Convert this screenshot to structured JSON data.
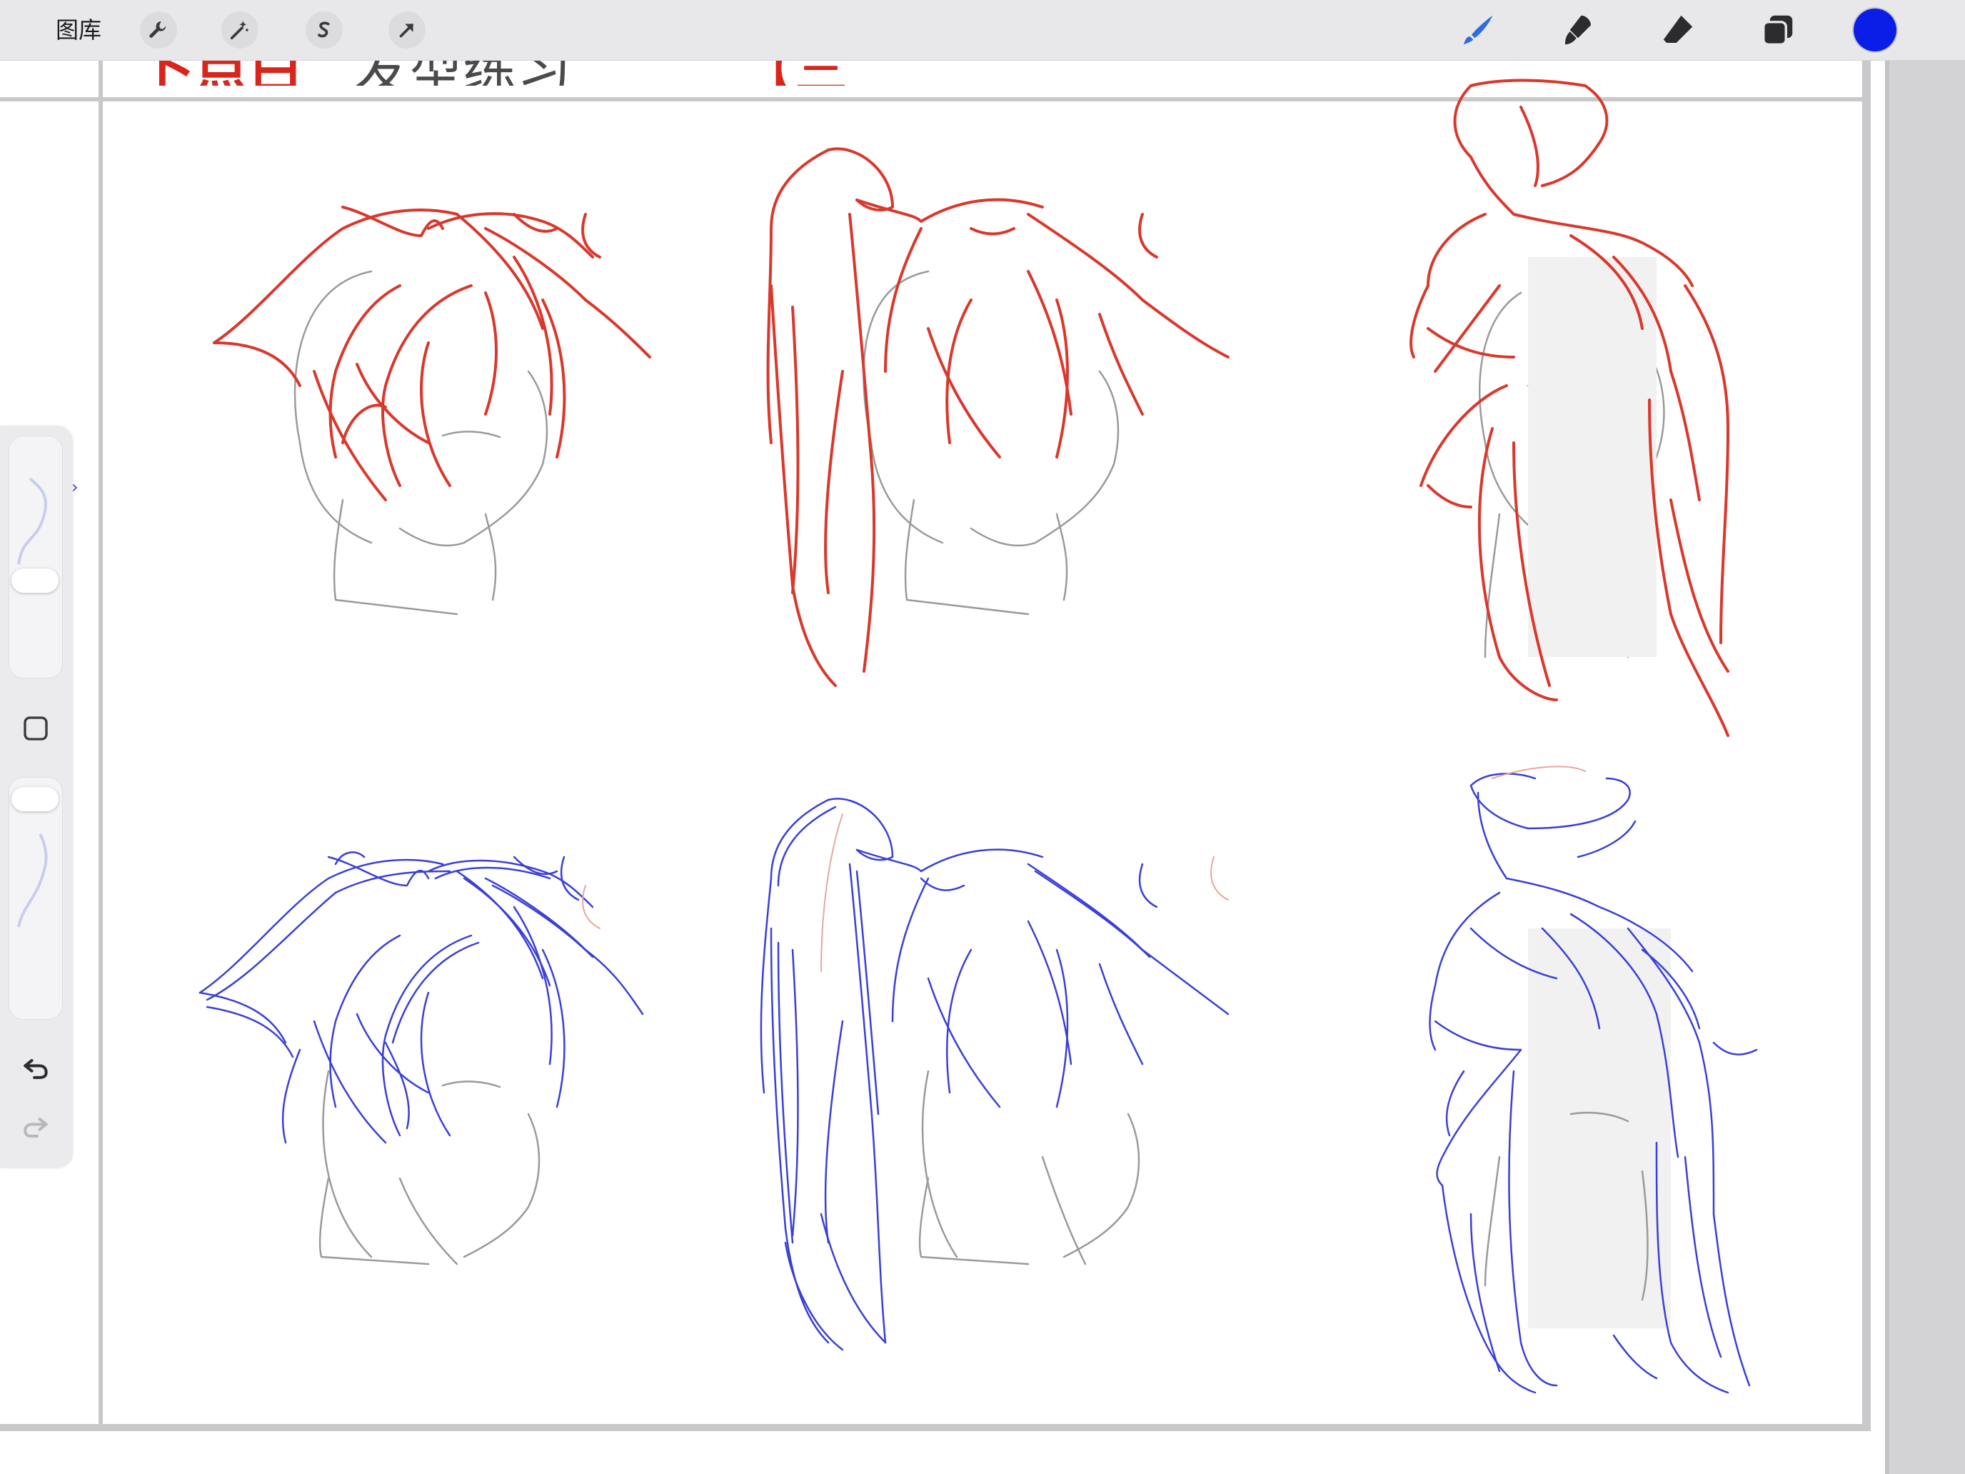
{
  "toolbar": {
    "gallery_label": "图库",
    "left_tools": [
      {
        "name": "actions",
        "icon": "wrench-icon"
      },
      {
        "name": "adjustments",
        "icon": "magic-wand-icon"
      },
      {
        "name": "selection",
        "icon": "selection-s-icon"
      },
      {
        "name": "transform",
        "icon": "arrow-cursor-icon"
      }
    ],
    "right_tools": [
      {
        "name": "brush",
        "icon": "brush-icon",
        "active": true
      },
      {
        "name": "smudge",
        "icon": "smudge-icon"
      },
      {
        "name": "eraser",
        "icon": "eraser-icon"
      },
      {
        "name": "layers",
        "icon": "layers-icon"
      }
    ],
    "current_color": "#0a1ee8"
  },
  "sidebar": {
    "brush_size_slider": "brush-size-slider",
    "opacity_slider": "opacity-slider",
    "modify_button": "square-icon",
    "undo": "undo-icon",
    "redo": "redo-icon"
  },
  "canvas": {
    "title_red": "卜点白",
    "title_grey": "发型练习",
    "title_bracket": "【三选二】",
    "sketch_colors": {
      "reference_lines": "#d9382c",
      "practice_lines": "#3a3fd6",
      "base_lines": "#8a8a8a"
    }
  }
}
